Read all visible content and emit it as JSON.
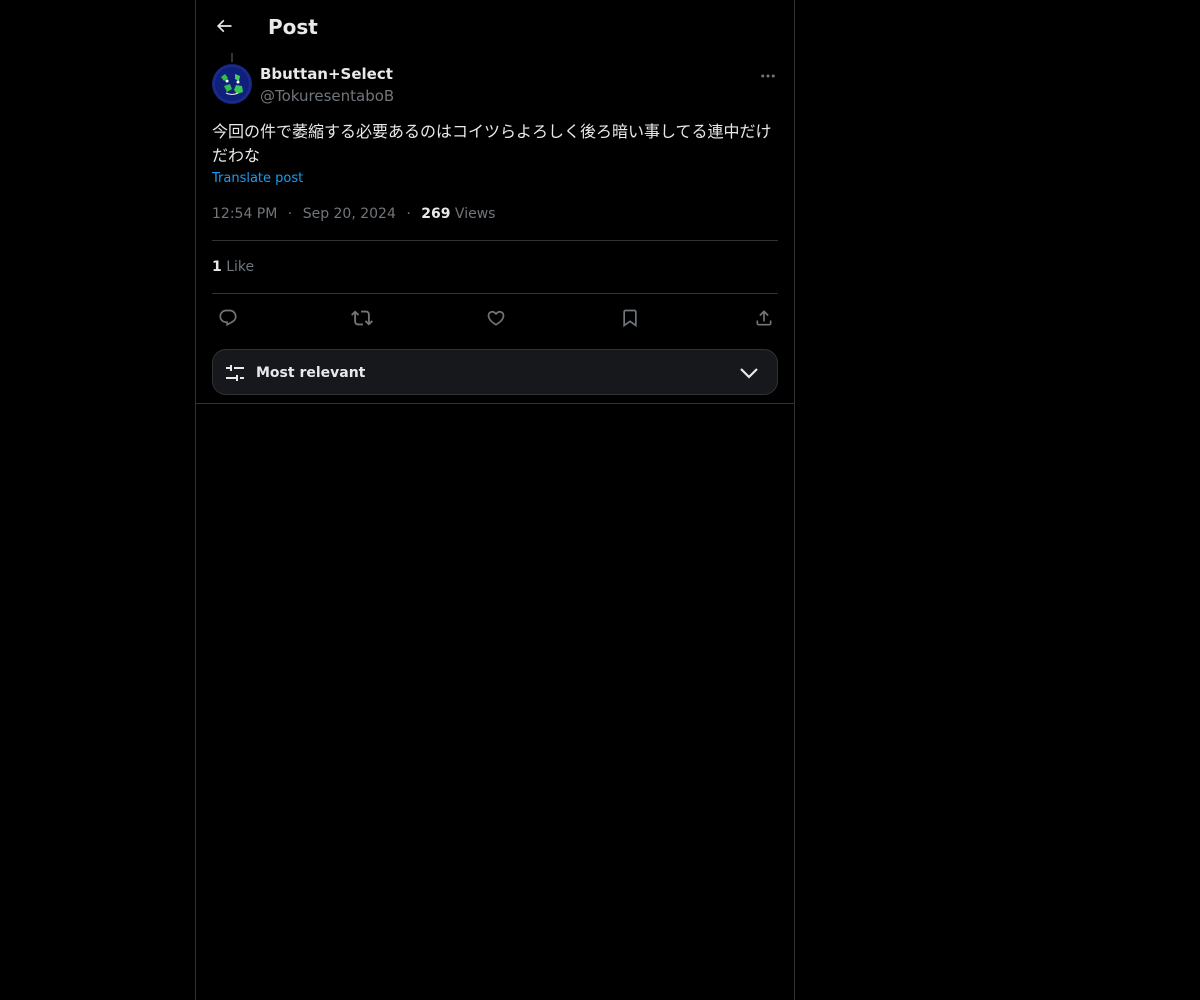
{
  "header": {
    "back_icon": "arrow-left-icon",
    "title": "Post"
  },
  "author": {
    "display_name": "Bbuttan+Select",
    "handle": "@TokuresentaboB",
    "avatar_colors": [
      "#1a2a8c",
      "#2fbf4a"
    ]
  },
  "post": {
    "text": "今回の件で萎縮する必要あるのはコイツらよろしく後ろ暗い事してる連中だけだわな",
    "translate_label": "Translate post",
    "time": "12:54 PM",
    "separator": "·",
    "date": "Sep 20, 2024",
    "views_count": "269",
    "views_label": "Views",
    "likes_count": "1",
    "likes_label": "Like"
  },
  "actions": [
    {
      "name": "reply-icon"
    },
    {
      "name": "repost-icon"
    },
    {
      "name": "like-icon"
    },
    {
      "name": "bookmark-icon"
    },
    {
      "name": "share-icon"
    }
  ],
  "replies_sort": {
    "icon": "sliders-icon",
    "label": "Most relevant",
    "chevron": "chevron-down-icon"
  },
  "colors": {
    "background": "#000000",
    "text": "#e7e9ea",
    "muted": "#71767b",
    "link": "#1d9bf0",
    "border": "#2f3336"
  }
}
